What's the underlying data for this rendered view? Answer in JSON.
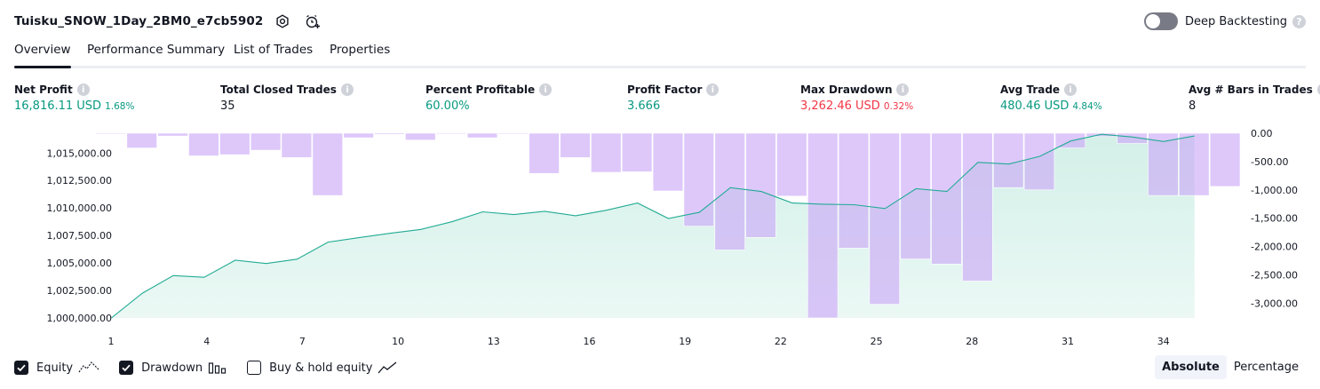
{
  "header": {
    "title": "Tuisku_SNOW_1Day_2BM0_e7cb5902",
    "deep_backtesting_label": "Deep Backtesting",
    "deep_backtesting_on": false,
    "help_glyph": "?"
  },
  "tabs": [
    {
      "label": "Overview",
      "active": true
    },
    {
      "label": "Performance Summary",
      "active": false
    },
    {
      "label": "List of Trades",
      "active": false
    },
    {
      "label": "Properties",
      "active": false
    }
  ],
  "info_glyph": "i",
  "metrics": [
    {
      "label": "Net Profit",
      "value": "16,816.11 USD",
      "pct": "1.68%",
      "color": "green"
    },
    {
      "label": "Total Closed Trades",
      "value": "35",
      "pct": "",
      "color": "dark"
    },
    {
      "label": "Percent Profitable",
      "value": "60.00%",
      "pct": "",
      "color": "green"
    },
    {
      "label": "Profit Factor",
      "value": "3.666",
      "pct": "",
      "color": "green"
    },
    {
      "label": "Max Drawdown",
      "value": "3,262.46 USD",
      "pct": "0.32%",
      "color": "red"
    },
    {
      "label": "Avg Trade",
      "value": "480.46 USD",
      "pct": "4.84%",
      "color": "green"
    },
    {
      "label": "Avg # Bars in Trades",
      "value": "8",
      "pct": "",
      "color": "dark"
    }
  ],
  "chart_data": {
    "type": "area",
    "x_ticks": [
      "1",
      "4",
      "7",
      "10",
      "13",
      "16",
      "19",
      "22",
      "25",
      "28",
      "31",
      "34"
    ],
    "left_axis": {
      "ticks": [
        "1,000,000.00",
        "1,002,500.00",
        "1,005,000.00",
        "1,007,500.00",
        "1,010,000.00",
        "1,012,500.00",
        "1,015,000.00"
      ],
      "ylim": [
        1000000,
        1016800
      ]
    },
    "right_axis": {
      "ticks": [
        "0.00",
        "-500.00",
        "-1,000.00",
        "-1,500.00",
        "-2,000.00",
        "-2,500.00",
        "-3,000.00"
      ],
      "ylim": [
        -3262,
        0
      ]
    },
    "series": [
      {
        "name": "Equity",
        "color": "#22ab94",
        "fill": "#d3f0e8",
        "values": [
          1000000,
          1002250,
          1003850,
          1003700,
          1005250,
          1004950,
          1005350,
          1006900,
          1007300,
          1007700,
          1008050,
          1008750,
          1009650,
          1009400,
          1009700,
          1009300,
          1009800,
          1010450,
          1009050,
          1009600,
          1011850,
          1011500,
          1010450,
          1010350,
          1010300,
          1009950,
          1011750,
          1011500,
          1014150,
          1014000,
          1014700,
          1016100,
          1016700,
          1016450,
          1016050,
          1016550
        ]
      },
      {
        "name": "Drawdown",
        "color": "#c9a6f7",
        "values": [
          -15,
          -260,
          -50,
          -400,
          -380,
          -300,
          -430,
          -1100,
          -80,
          -20,
          -120,
          -10,
          -80,
          -10,
          -710,
          -430,
          -690,
          -680,
          -1020,
          -1640,
          -2060,
          -1840,
          -1110,
          -3262,
          -2030,
          -3020,
          -2220,
          -2310,
          -2610,
          -960,
          -1000,
          -260,
          -60,
          -180,
          -1100,
          -1100,
          -940
        ]
      }
    ]
  },
  "legend": [
    {
      "label": "Equity",
      "checked": true,
      "icon": "equity-line-icon"
    },
    {
      "label": "Drawdown",
      "checked": true,
      "icon": "drawdown-bars-icon"
    },
    {
      "label": "Buy & hold equity",
      "checked": false,
      "icon": "buy-hold-line-icon"
    }
  ],
  "modes": [
    {
      "label": "Absolute",
      "active": true
    },
    {
      "label": "Percentage",
      "active": false
    }
  ],
  "colors": {
    "green": "#089981",
    "red": "#f23645",
    "dark": "#131722"
  }
}
